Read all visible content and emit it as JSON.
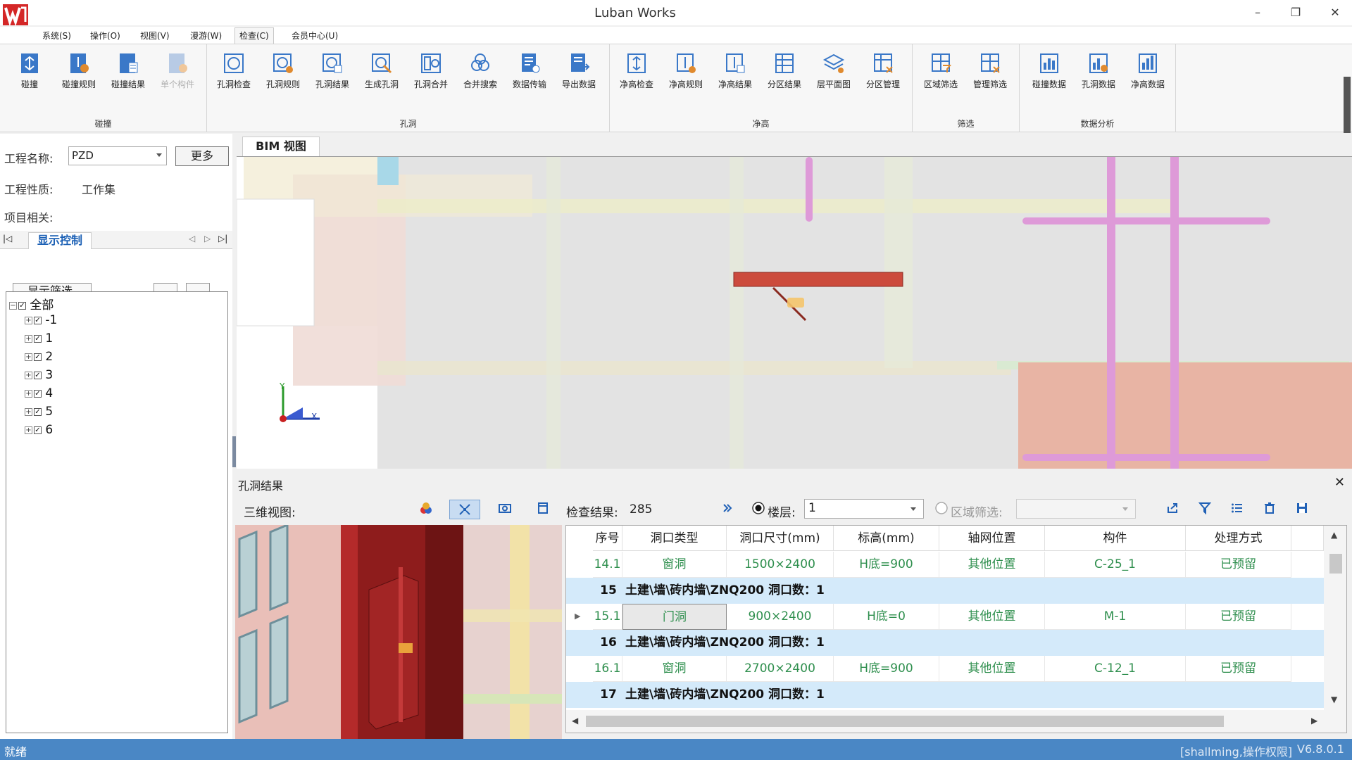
{
  "window": {
    "title": "Luban Works",
    "minimize": "–",
    "restore": "❐",
    "close": "✕"
  },
  "menu": [
    {
      "label": "系统(S)"
    },
    {
      "label": "操作(O)"
    },
    {
      "label": "视图(V)"
    },
    {
      "label": "漫游(W)"
    },
    {
      "label": "检查(C)"
    },
    {
      "label": "会员中心(U)"
    }
  ],
  "ribbon": {
    "groups": [
      {
        "label": "碰撞",
        "buttons": [
          "碰撞",
          "碰撞规则",
          "碰撞结果",
          "单个构件"
        ]
      },
      {
        "label": "孔洞",
        "buttons": [
          "孔洞检查",
          "孔洞规则",
          "孔洞结果",
          "生成孔洞",
          "孔洞合并",
          "合并搜索",
          "数据传输",
          "导出数据"
        ]
      },
      {
        "label": "净高",
        "buttons": [
          "净高检查",
          "净高规则",
          "净高结果",
          "分区结果",
          "层平面图",
          "分区管理"
        ]
      },
      {
        "label": "筛选",
        "buttons": [
          "区域筛选",
          "管理筛选"
        ]
      },
      {
        "label": "数据分析",
        "buttons": [
          "碰撞数据",
          "孔洞数据",
          "净高数据"
        ]
      }
    ]
  },
  "left_panel": {
    "project_name_label": "工程名称:",
    "project_name_value": "PZD",
    "more_button": "更多",
    "project_type_label": "工程性质:",
    "project_type_value": "工作集",
    "project_related_label": "项目相关:",
    "tab_label": "显示控制",
    "filter_label": "显示筛选",
    "tree": {
      "root": "全部",
      "children": [
        "-1",
        "1",
        "2",
        "3",
        "4",
        "5",
        "6"
      ]
    }
  },
  "bim_view": {
    "tab_label": "BIM 视图",
    "axis_y": "Y",
    "axis_x": "X"
  },
  "result_panel": {
    "title": "孔洞结果",
    "view_label": "三维视图:",
    "check_result_label": "检查结果:",
    "check_result_value": "285",
    "floor_label": "楼层:",
    "floor_value": "1",
    "region_label": "区域筛选:",
    "columns": [
      "序号",
      "洞口类型",
      "洞口尺寸(mm)",
      "标高(mm)",
      "轴网位置",
      "构件",
      "处理方式"
    ],
    "rows": [
      {
        "type": "item",
        "seq": "14.1",
        "hole_type": "窗洞",
        "size": "1500×2400",
        "elev": "H底=900",
        "grid": "其他位置",
        "member": "C-25_1",
        "handle": "已预留"
      },
      {
        "type": "group",
        "seq": "15",
        "text": "土建\\墙\\砖内墙\\ZNQ200  洞口数：1"
      },
      {
        "type": "item",
        "seq": "15.1",
        "hole_type": "门洞",
        "size": "900×2400",
        "elev": "H底=0",
        "grid": "其他位置",
        "member": "M-1",
        "handle": "已预留"
      },
      {
        "type": "group",
        "seq": "16",
        "text": "土建\\墙\\砖内墙\\ZNQ200  洞口数：1"
      },
      {
        "type": "item",
        "seq": "16.1",
        "hole_type": "窗洞",
        "size": "2700×2400",
        "elev": "H底=900",
        "grid": "其他位置",
        "member": "C-12_1",
        "handle": "已预留"
      },
      {
        "type": "group",
        "seq": "17",
        "text": "土建\\墙\\砖内墙\\ZNQ200  洞口数：1"
      }
    ]
  },
  "status": {
    "left": "就绪",
    "user": "[shallming,操作权限]",
    "version": "V6.8.0.1"
  },
  "colors": {
    "status_bg": "#4a87c5",
    "group_row_bg": "#d4eafa",
    "item_text": "#2f8f4e",
    "accent_blue": "#1a5fb4"
  }
}
